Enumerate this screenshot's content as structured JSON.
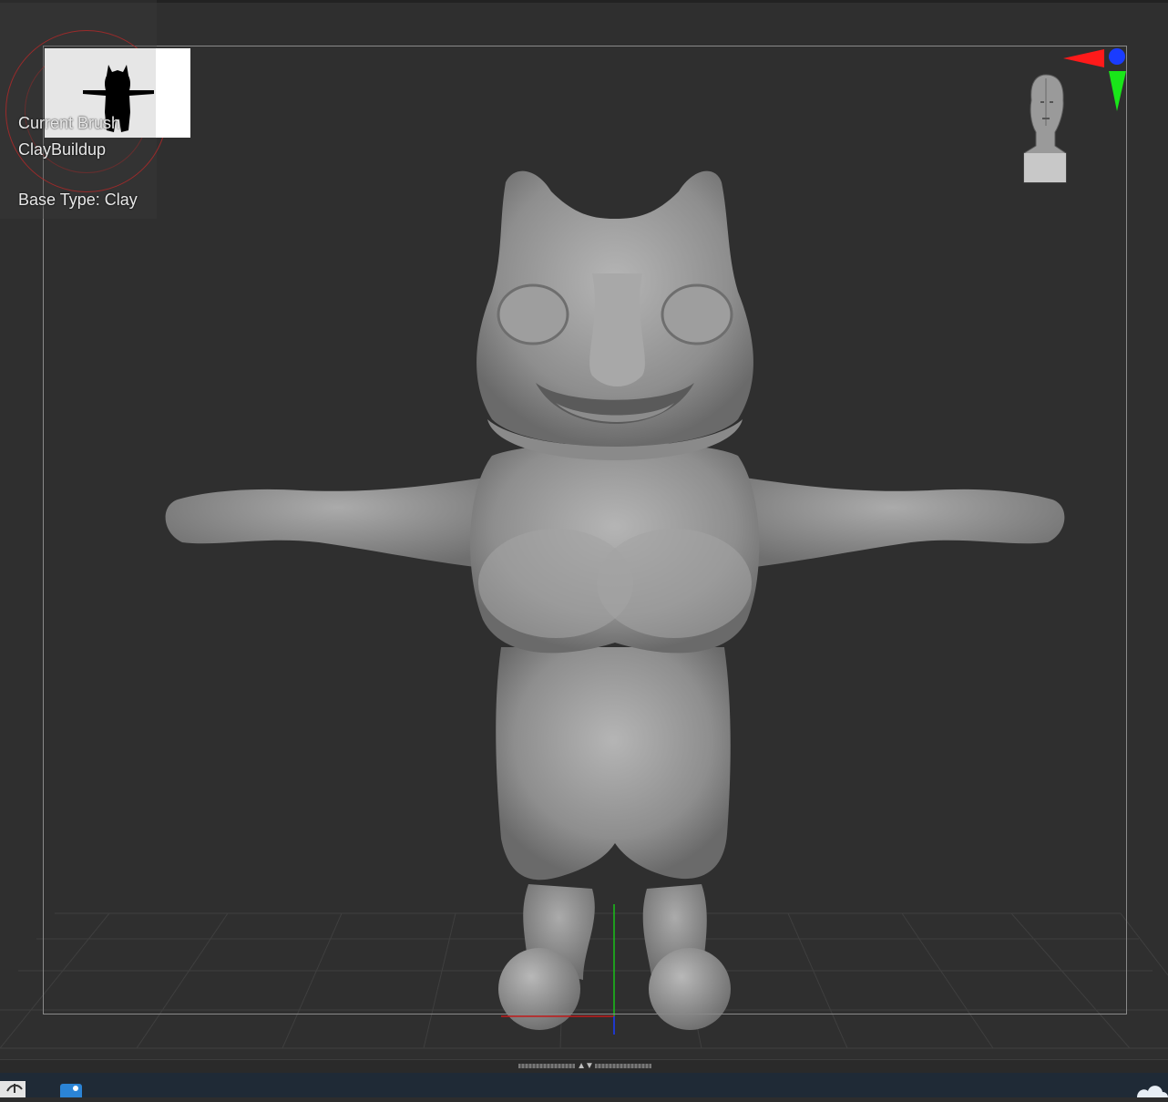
{
  "brush": {
    "title": "Current Brush",
    "name": "ClayBuildup",
    "base_type": "Base Type: Clay"
  },
  "icons": {
    "gizmo": "axis-gizmo-icon",
    "head": "head-orientation-icon",
    "splitter": "splitter-arrows-icon",
    "taskbar_app_1": "app-icon",
    "taskbar_app_2": "image-app-icon",
    "tray": "cloud-icon"
  },
  "colors": {
    "viewport_bg": "#2f2f2f",
    "model_gray": "#9a9a9a",
    "axis_x": "#ff1a1a",
    "axis_y": "#19e619",
    "axis_z": "#1a3cff",
    "taskbar": "#1f2a36"
  }
}
